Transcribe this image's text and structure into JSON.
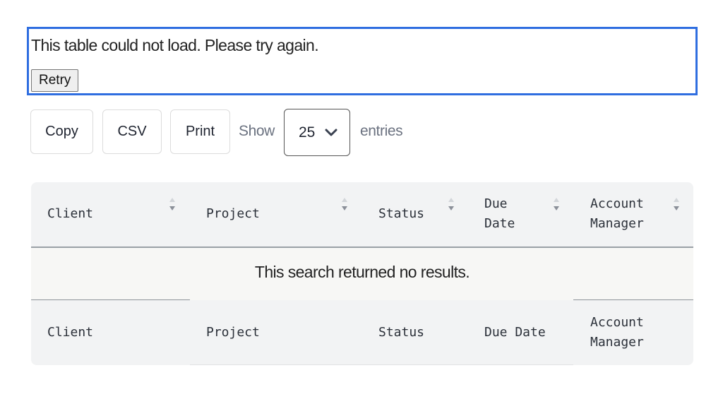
{
  "error": {
    "message": "This table could not load. Please try again.",
    "retry_label": "Retry"
  },
  "toolbar": {
    "copy_label": "Copy",
    "csv_label": "CSV",
    "print_label": "Print",
    "show_label": "Show",
    "page_length": "25",
    "entries_label": "entries"
  },
  "table": {
    "columns": [
      "Client",
      "Project",
      "Status",
      "Due\nDate",
      "Account\nManager"
    ],
    "footer_columns": [
      "Client",
      "Project",
      "Status",
      "Due Date",
      "Account\nManager"
    ],
    "empty_message": "This search returned no results."
  },
  "colors": {
    "focus_outline": "#2f6ee0",
    "header_bg": "#f2f3f4",
    "muted_text": "#6b7280"
  },
  "icons": {
    "sort": "sort-arrows-icon",
    "dropdown": "chevron-down-icon"
  }
}
